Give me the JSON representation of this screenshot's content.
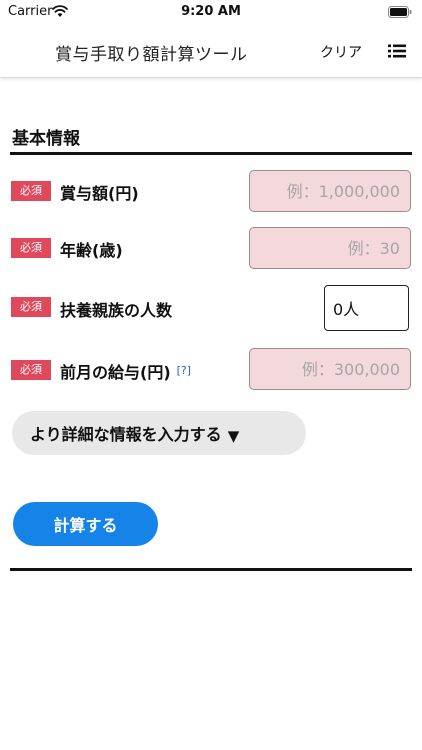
{
  "status_bar": {
    "carrier": "Carrier",
    "time": "9:20 AM"
  },
  "nav": {
    "title": "賞与手取り額計算ツール",
    "clear_label": "クリア",
    "menu_icon": "list-menu-icon"
  },
  "section": {
    "title": "基本情報"
  },
  "fields": [
    {
      "badge": "必須",
      "label": "賞与額(円)",
      "placeholder": "例：1,000,000"
    },
    {
      "badge": "必須",
      "label": "年齢(歳)",
      "placeholder": "例：30"
    },
    {
      "badge": "必須",
      "label": "扶養親族の人数",
      "value": "0人"
    },
    {
      "badge": "必須",
      "label": "前月の給与(円)",
      "help": "[?]",
      "placeholder": "例：300,000"
    }
  ],
  "detail_toggle": {
    "label": "より詳細な情報を入力する",
    "arrow": "▼"
  },
  "calc_button": {
    "label": "計算する"
  },
  "colors": {
    "badge": "#e0495b",
    "input_fill": "#f3d8dc",
    "primary_button": "#1583e8",
    "toggle_fill": "#e8e8e8",
    "help_link": "#2a63b8"
  }
}
